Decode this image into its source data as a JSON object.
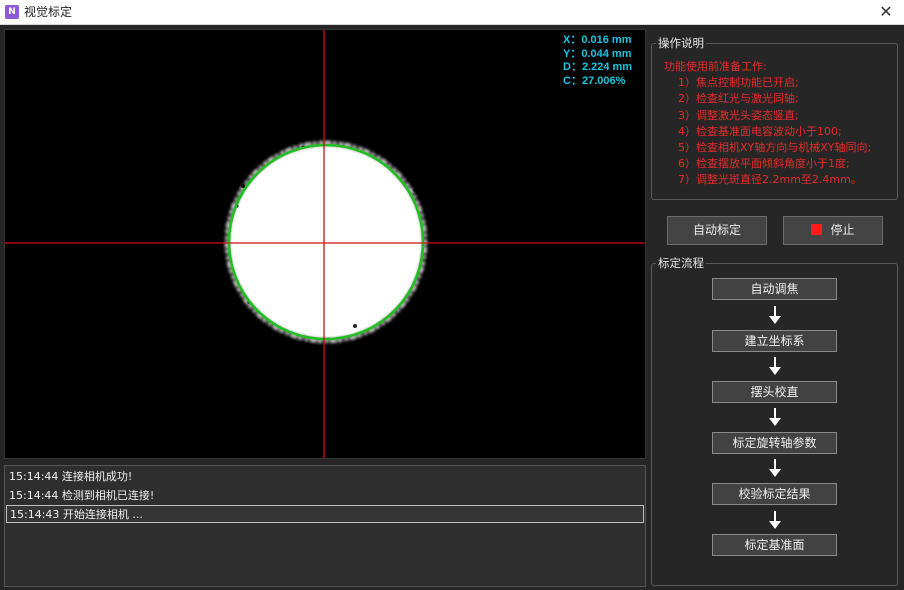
{
  "window": {
    "title": "视觉标定",
    "close_glyph": "✕",
    "icon": "app-logo-icon"
  },
  "camera": {
    "readout": {
      "x": "X：0.016 mm",
      "y": "Y：0.044 mm",
      "d": "D：2.224 mm",
      "c": "C：27.006%"
    },
    "colors": {
      "crosshair": "#d01010",
      "fit_circle": "#1fbf1f",
      "readout": "#19c5e0"
    }
  },
  "log": {
    "lines": [
      "15:14:44 连接相机成功!",
      "15:14:44 检测到相机已连接!",
      "15:14:43 开始连接相机 ..."
    ],
    "selected_index": 2
  },
  "instructions": {
    "title": "操作说明",
    "header": "功能使用前准备工作:",
    "steps": [
      "1）焦点控制功能已开启;",
      "2）检查红光与激光同轴;",
      "3）调整激光头姿态竖直;",
      "4）检查基准面电容波动小于100;",
      "5）检查相机XY轴方向与机械XY轴同向;",
      "6）检查摆放平面倾斜角度小于1度;",
      "7）调整光斑直径2.2mm至2.4mm。"
    ],
    "color": "#e82a2a"
  },
  "buttons": {
    "auto_calibrate": "自动标定",
    "stop": "停止",
    "stop_color": "#ff1a1a"
  },
  "flow": {
    "title": "标定流程",
    "steps": [
      "自动调焦",
      "建立坐标系",
      "摆头校直",
      "标定旋转轴参数",
      "校验标定结果",
      "标定基准面"
    ]
  }
}
